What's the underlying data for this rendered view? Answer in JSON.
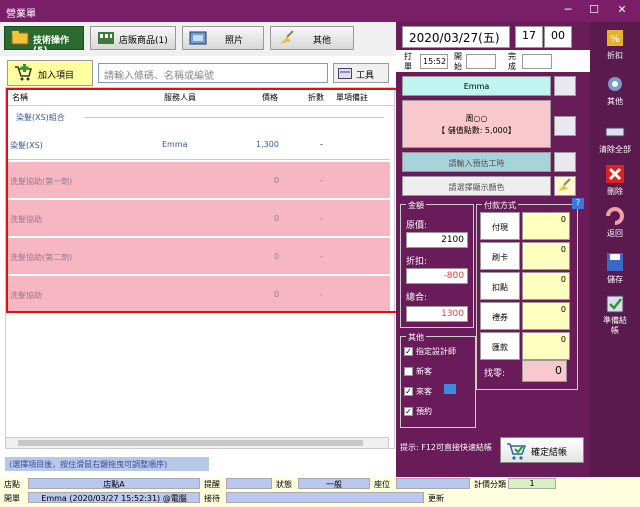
{
  "window": {
    "title": "營業單"
  },
  "tabs": [
    {
      "label": "技術操作(5)",
      "active": true
    },
    {
      "label": "店販商品(1)",
      "active": false
    },
    {
      "label": "照片",
      "active": false
    },
    {
      "label": "其他",
      "active": false
    }
  ],
  "toolbar": {
    "add_item_label": "加入項目",
    "search_placeholder": "請輸入條碼、名稱或編號",
    "tools_label": "工具"
  },
  "grid": {
    "headers": [
      "名稱",
      "服務人員",
      "價格",
      "折數",
      "單項備註"
    ],
    "group_label": "染髮(XS)組合",
    "rows": [
      {
        "name": "染髮(XS)",
        "staff": "Emma",
        "price": "1,300",
        "discount": "-",
        "highlight": false
      },
      {
        "name": "洗髮協助(第一劑)",
        "staff": "",
        "price": "0",
        "discount": "-",
        "highlight": true
      },
      {
        "name": "洗髮協助",
        "staff": "",
        "price": "0",
        "discount": "-",
        "highlight": true
      },
      {
        "name": "洗髮協助(第二劑)",
        "staff": "",
        "price": "0",
        "discount": "-",
        "highlight": true
      },
      {
        "name": "洗髮協助",
        "staff": "",
        "price": "0",
        "discount": "-",
        "highlight": true
      }
    ]
  },
  "hint": "(選擇項目後，按住滑鼠右鍵拖曳可調整順序)",
  "datetime": {
    "date": "2020/03/27(五)",
    "hour": "17",
    "minute": "00",
    "punch_label": "打單",
    "punch_time": "15:52",
    "assign_label": "開始",
    "finish_label": "完成"
  },
  "customer": {
    "staff_name": "Emma",
    "line1": "周○○",
    "line2": "【 儲值點數: 5,000】",
    "work_hours_btn": "請輸入預估工時",
    "color_btn": "請選擇顯示顏色"
  },
  "amount": {
    "section_label": "金額",
    "original_label": "原價:",
    "original_value": "2100",
    "discount_label": "折扣:",
    "discount_value": "-800",
    "total_label": "總合:",
    "total_value": "1300"
  },
  "payment": {
    "section_label": "付款方式",
    "methods": [
      {
        "label": "付現",
        "value": "0"
      },
      {
        "label": "刷卡",
        "value": "0"
      },
      {
        "label": "扣點",
        "value": "0"
      },
      {
        "label": "禮券",
        "value": "0"
      },
      {
        "label": "匯款",
        "value": "0"
      }
    ],
    "change_label": "找零:",
    "change_value": "0"
  },
  "other": {
    "section_label": "其他",
    "options": [
      {
        "label": "指定設計師",
        "checked": true
      },
      {
        "label": "新客",
        "checked": false
      },
      {
        "label": "來客",
        "checked": true
      },
      {
        "label": "預約",
        "checked": true
      }
    ]
  },
  "footer_hint": "提示: F12可直接快速結帳",
  "confirm_label": "確定結帳",
  "right_tools": [
    {
      "label": "折扣",
      "icon": "discount-icon"
    },
    {
      "label": "其他",
      "icon": "gear-icon"
    },
    {
      "label": "清除全部",
      "icon": "clear-all-icon"
    },
    {
      "label": "刪除",
      "icon": "delete-icon"
    },
    {
      "label": "返回",
      "icon": "undo-icon"
    },
    {
      "label": "儲存",
      "icon": "save-icon"
    },
    {
      "label": "準備結帳",
      "icon": "checkout-prep-icon"
    }
  ],
  "status": {
    "store_label": "店點",
    "store_value": "店點A",
    "reminder_label": "提醒",
    "state_label": "狀態",
    "state_value": "一般",
    "seat_label": "座位",
    "period_label": "計價分類",
    "period_value": "1",
    "opener_label": "開單",
    "opener_value": "Emma (2020/03/27 15:52:31) @電腦",
    "reception_label": "接待",
    "update_label": "更新"
  }
}
